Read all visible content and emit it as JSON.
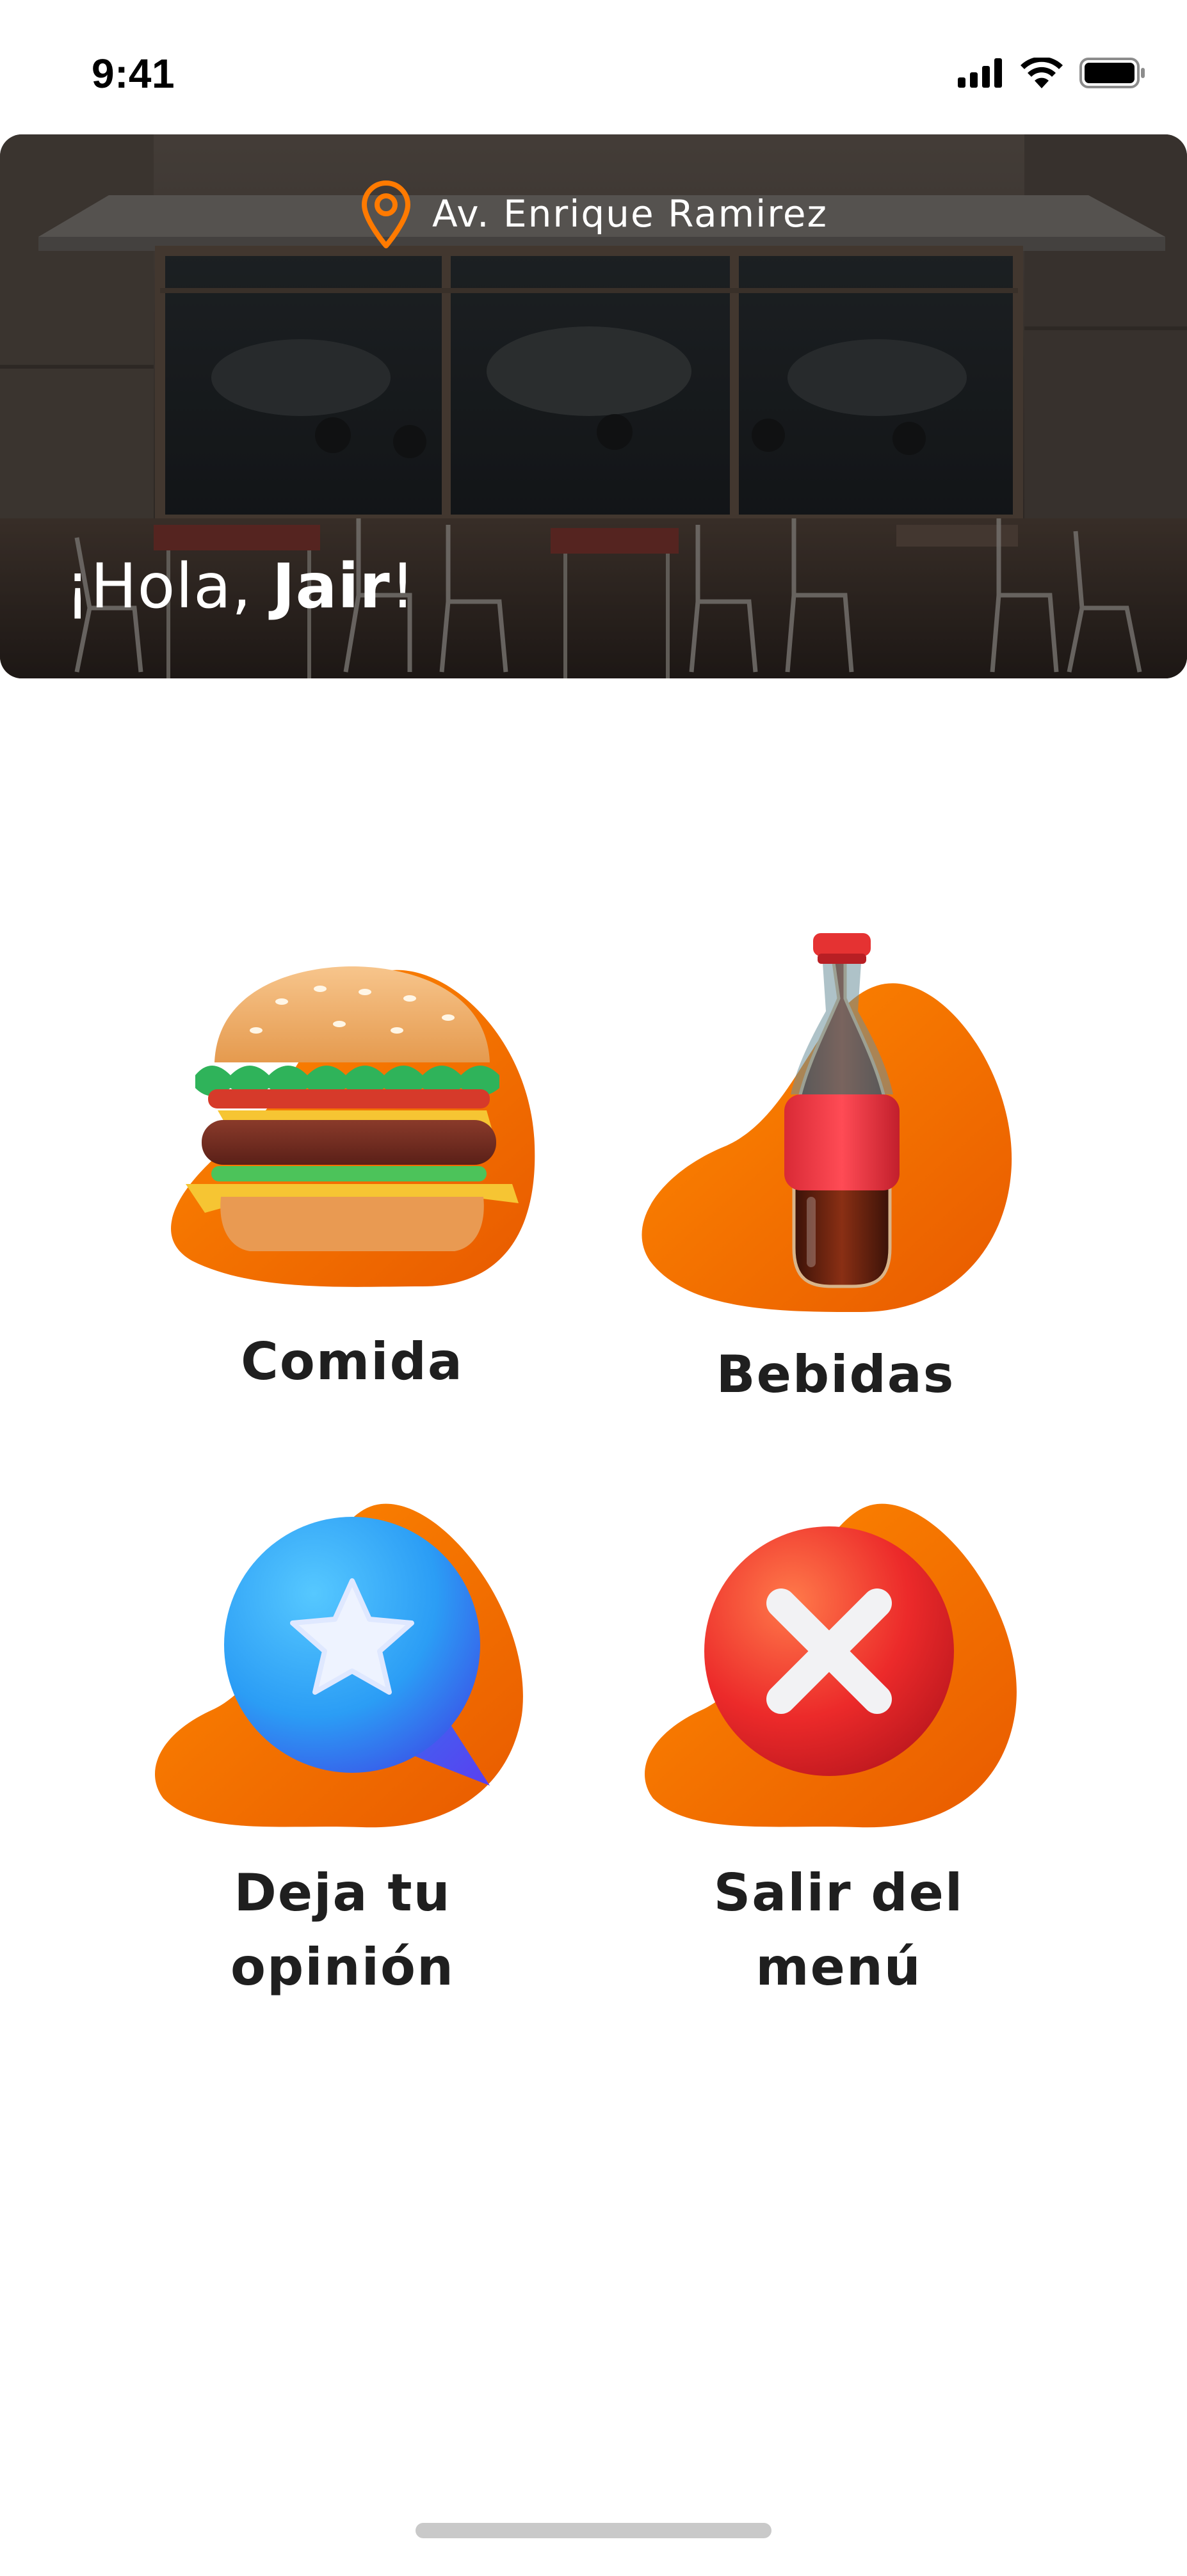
{
  "status_bar": {
    "time": "9:41",
    "icons": [
      "cellular-signal-icon",
      "wifi-icon",
      "battery-icon"
    ]
  },
  "header": {
    "location_icon": "map-pin-icon",
    "location": "Av. Enrique Ramirez",
    "greeting_prefix": "¡Hola, ",
    "user_name": "Jair",
    "greeting_suffix": "!"
  },
  "menu": {
    "food": {
      "label": "Comida",
      "icon": "burger-icon"
    },
    "drinks": {
      "label": "Bebidas",
      "icon": "soda-bottle-icon"
    },
    "feedback": {
      "label_line1": "Deja tu",
      "label_line2": "opinión",
      "icon": "star-chat-icon"
    },
    "exit": {
      "label_line1": "Salir del",
      "label_line2": "menú",
      "icon": "close-circle-icon"
    }
  },
  "colors": {
    "accent": "#FF7A00",
    "accent_dark": "#E85A00",
    "text": "#1F1F1F",
    "background": "#FFFFFF"
  }
}
